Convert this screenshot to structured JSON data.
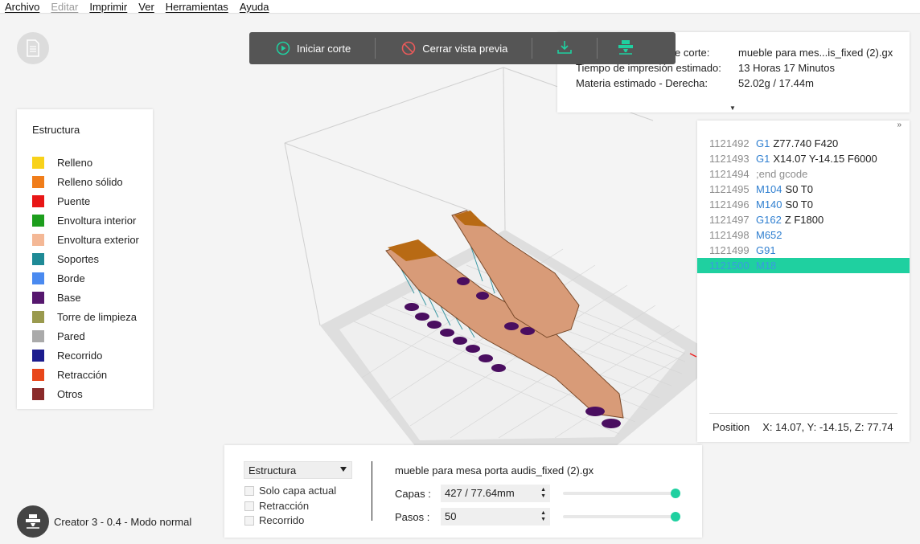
{
  "menu": {
    "items": [
      {
        "label": "Archivo",
        "disabled": false
      },
      {
        "label": "Editar",
        "disabled": true
      },
      {
        "label": "Imprimir",
        "disabled": false
      },
      {
        "label": "Ver",
        "disabled": false
      },
      {
        "label": "Herramientas",
        "disabled": false
      },
      {
        "label": "Ayuda",
        "disabled": false
      }
    ]
  },
  "toolbar": {
    "start_slice_label": "Iniciar corte",
    "close_preview_label": "Cerrar vista previa",
    "accent": "#1fd0a0",
    "danger": "#e85a5a"
  },
  "info": {
    "rows": [
      {
        "key": "e corte:",
        "value": "mueble para mes...is_fixed (2).gx"
      },
      {
        "key": "Tiempo de impresión estimado:",
        "value": "13 Horas 17 Minutos"
      },
      {
        "key": "Materia estimado - Derecha:",
        "value": "52.02g / 17.44m"
      }
    ]
  },
  "legend": {
    "title": "Estructura",
    "items": [
      {
        "label": "Relleno",
        "color": "#f8d21a"
      },
      {
        "label": "Relleno sólido",
        "color": "#f07d1a"
      },
      {
        "label": "Puente",
        "color": "#e81616"
      },
      {
        "label": "Envoltura interior",
        "color": "#1d9e1d"
      },
      {
        "label": "Envoltura exterior",
        "color": "#f4b896"
      },
      {
        "label": "Soportes",
        "color": "#1f8a96"
      },
      {
        "label": "Borde",
        "color": "#4a8af0"
      },
      {
        "label": "Base",
        "color": "#56176e"
      },
      {
        "label": "Torre de limpieza",
        "color": "#9a9a4e"
      },
      {
        "label": "Pared",
        "color": "#aaaaaa"
      },
      {
        "label": "Recorrido",
        "color": "#1c1c8e"
      },
      {
        "label": "Retracción",
        "color": "#e8461a"
      },
      {
        "label": "Otros",
        "color": "#8a2a2a"
      }
    ]
  },
  "gcode": {
    "lines": [
      {
        "num": "1121492",
        "cmd": "G1",
        "args": "Z77.740 F420"
      },
      {
        "num": "1121493",
        "cmd": "G1",
        "args": "X14.07 Y-14.15 F6000"
      },
      {
        "num": "1121494",
        "cmd": "",
        "args": ";end gcode"
      },
      {
        "num": "1121495",
        "cmd": "M104",
        "args": "S0 T0"
      },
      {
        "num": "1121496",
        "cmd": "M140",
        "args": "S0 T0"
      },
      {
        "num": "1121497",
        "cmd": "G162",
        "args": "Z F1800"
      },
      {
        "num": "1121498",
        "cmd": "M652",
        "args": ""
      },
      {
        "num": "1121499",
        "cmd": "G91",
        "args": ""
      },
      {
        "num": "1121500",
        "cmd": "M18",
        "args": ""
      }
    ],
    "active_index": 8,
    "position_label": "Position",
    "position_value": "X: 14.07, Y: -14.15, Z: 77.74"
  },
  "bottom": {
    "view_select": "Estructura",
    "checkboxes": [
      {
        "label": "Solo capa actual",
        "checked": false
      },
      {
        "label": "Retracción",
        "checked": false
      },
      {
        "label": "Recorrido",
        "checked": false
      }
    ],
    "filename": "mueble para mesa porta audis_fixed (2).gx",
    "layers_label": "Capas :",
    "layers_value": "427 / 77.64mm",
    "layers_fraction": 1.0,
    "steps_label": "Pasos :",
    "steps_value": "50",
    "steps_fraction": 1.0
  },
  "printer": {
    "label": "Creator 3 - 0.4 - Modo normal"
  }
}
